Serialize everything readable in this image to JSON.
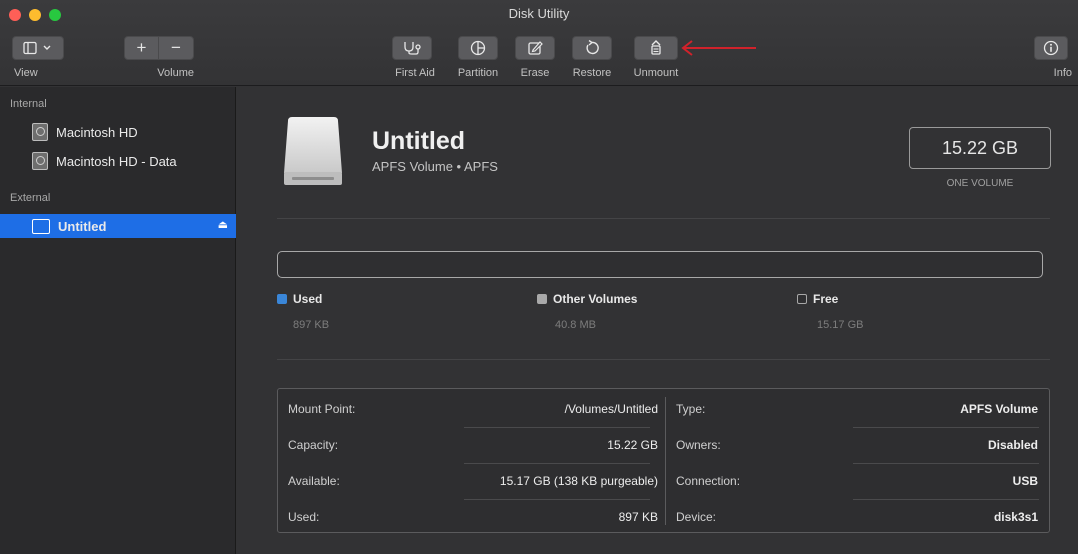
{
  "window": {
    "title": "Disk Utility"
  },
  "toolbar": {
    "view_label": "View",
    "volume_label": "Volume",
    "volume_add": "+",
    "volume_remove": "−",
    "first_aid_label": "First Aid",
    "partition_label": "Partition",
    "erase_label": "Erase",
    "restore_label": "Restore",
    "unmount_label": "Unmount",
    "info_label": "Info"
  },
  "sidebar": {
    "internal_header": "Internal",
    "external_header": "External",
    "internal_items": [
      {
        "label": "Macintosh HD"
      },
      {
        "label": "Macintosh HD - Data"
      }
    ],
    "external_items": [
      {
        "label": "Untitled",
        "selected": true
      }
    ]
  },
  "volume": {
    "name": "Untitled",
    "subtitle": "APFS Volume • APFS",
    "capacity": "15.22 GB",
    "capacity_note": "ONE VOLUME"
  },
  "usage": {
    "used": {
      "label": "Used",
      "value": "897 KB",
      "color": "#3a86d8"
    },
    "other": {
      "label": "Other Volumes",
      "value": "40.8 MB",
      "color": "#a9a9a9"
    },
    "free": {
      "label": "Free",
      "value": "15.17 GB",
      "color": "#2f2f31"
    }
  },
  "info": {
    "left": [
      {
        "key": "Mount Point:",
        "value": "/Volumes/Untitled"
      },
      {
        "key": "Capacity:",
        "value": "15.22 GB"
      },
      {
        "key": "Available:",
        "value": "15.17 GB (138 KB purgeable)"
      },
      {
        "key": "Used:",
        "value": "897 KB"
      }
    ],
    "right": [
      {
        "key": "Type:",
        "value": "APFS Volume"
      },
      {
        "key": "Owners:",
        "value": "Disabled"
      },
      {
        "key": "Connection:",
        "value": "USB"
      },
      {
        "key": "Device:",
        "value": "disk3s1"
      }
    ]
  },
  "colors": {
    "accent": "#1e6ee6",
    "annotation_arrow": "#d0222b"
  }
}
